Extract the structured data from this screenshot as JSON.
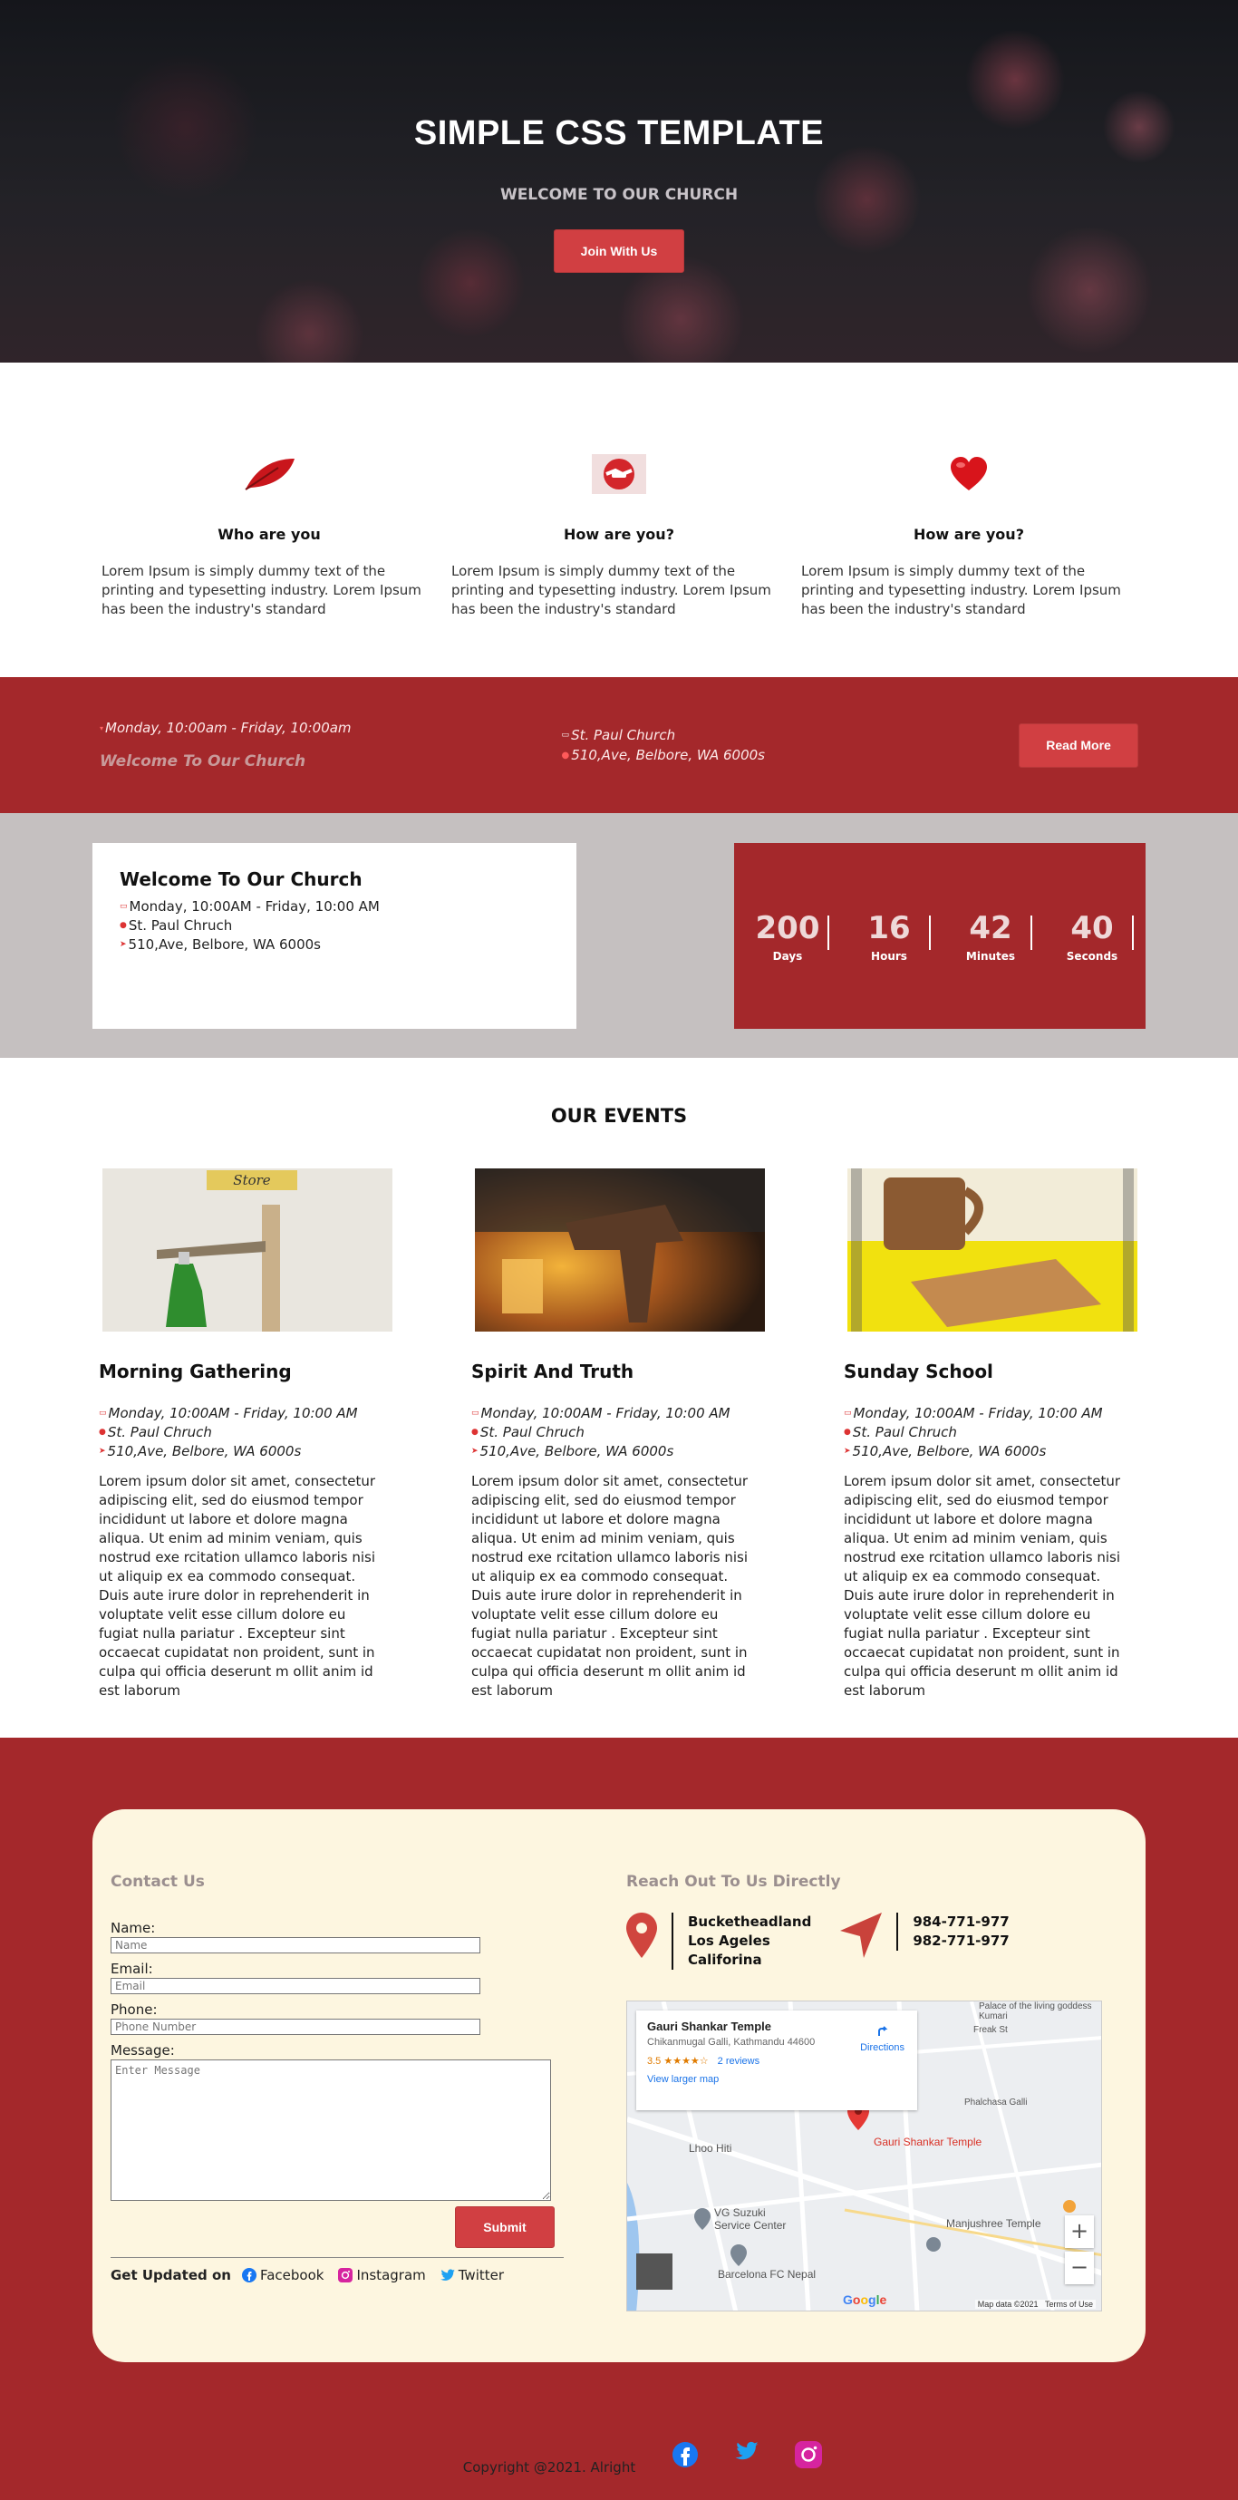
{
  "hero": {
    "title": "SIMPLE CSS TEMPLATE",
    "subtitle": "WELCOME TO OUR CHURCH",
    "button": "Join With Us"
  },
  "features": [
    {
      "icon": "leaf-icon",
      "title": "Who are you",
      "text": "Lorem Ipsum is simply dummy text of the printing and typesetting industry. Lorem Ipsum has been the industry's standard"
    },
    {
      "icon": "handshake-icon",
      "title": "How are you?",
      "text": "Lorem Ipsum is simply dummy text of the printing and typesetting industry. Lorem Ipsum has been the industry's standard"
    },
    {
      "icon": "heart-icon",
      "title": "How are you?",
      "text": "Lorem Ipsum is simply dummy text of the printing and typesetting industry. Lorem Ipsum has been the industry's standard"
    }
  ],
  "redbar": {
    "time": "Monday, 10:00am - Friday, 10:00am",
    "welcome": "Welcome To Our Church",
    "place": "St. Paul Church",
    "address": "510,Ave, Belbore, WA 6000s",
    "button": "Read More"
  },
  "welcome_card": {
    "title": "Welcome To Our Church",
    "time": "Monday, 10:00AM - Friday, 10:00 AM",
    "place": "St. Paul Chruch",
    "address": "510,Ave, Belbore, WA 6000s"
  },
  "countdown": [
    {
      "value": "200",
      "label": "Days"
    },
    {
      "value": "16",
      "label": "Hours"
    },
    {
      "value": "42",
      "label": "Minutes"
    },
    {
      "value": "40",
      "label": "Seconds"
    }
  ],
  "events": {
    "title": "OUR EVENTS",
    "items": [
      {
        "title": "Morning Gathering",
        "image_sign": "Store",
        "time": "Monday, 10:00AM - Friday, 10:00 AM",
        "place": "St. Paul Chruch",
        "address": "510,Ave, Belbore, WA 6000s",
        "text": "Lorem ipsum dolor sit amet, consectetur adipiscing elit, sed do eiusmod tempor incididunt ut labore et dolore magna aliqua. Ut enim ad minim veniam, quis nostrud exe rcitation ullamco laboris nisi ut aliquip ex ea commodo consequat. Duis aute irure dolor in reprehenderit in voluptate velit esse cillum dolore eu fugiat nulla pariatur . Excepteur sint occaecat cupidatat non proident, sunt in culpa qui officia deserunt m ollit anim id est laborum"
      },
      {
        "title": "Spirit And Truth",
        "time": "Monday, 10:00AM - Friday, 10:00 AM",
        "place": "St. Paul Chruch",
        "address": "510,Ave, Belbore, WA 6000s",
        "text": "Lorem ipsum dolor sit amet, consectetur adipiscing elit, sed do eiusmod tempor incididunt ut labore et dolore magna aliqua. Ut enim ad minim veniam, quis nostrud exe rcitation ullamco laboris nisi ut aliquip ex ea commodo consequat. Duis aute irure dolor in reprehenderit in voluptate velit esse cillum dolore eu fugiat nulla pariatur . Excepteur sint occaecat cupidatat non proident, sunt in culpa qui officia deserunt m ollit anim id est laborum"
      },
      {
        "title": "Sunday School",
        "time": "Monday, 10:00AM - Friday, 10:00 AM",
        "place": "St. Paul Chruch",
        "address": "510,Ave, Belbore, WA 6000s",
        "text": "Lorem ipsum dolor sit amet, consectetur adipiscing elit, sed do eiusmod tempor incididunt ut labore et dolore magna aliqua. Ut enim ad minim veniam, quis nostrud exe rcitation ullamco laboris nisi ut aliquip ex ea commodo consequat. Duis aute irure dolor in reprehenderit in voluptate velit esse cillum dolore eu fugiat nulla pariatur . Excepteur sint occaecat cupidatat non proident, sunt in culpa qui officia deserunt m ollit anim id est laborum"
      }
    ]
  },
  "contact": {
    "heading": "Contact Us",
    "name_label": "Name:",
    "name_placeholder": "Name",
    "email_label": "Email:",
    "email_placeholder": "Email",
    "phone_label": "Phone:",
    "phone_placeholder": "Phone Number",
    "message_label": "Message:",
    "message_placeholder": "Enter Message",
    "submit": "Submit",
    "updated_label": "Get Updated on",
    "facebook": "Facebook",
    "instagram": "Instagram",
    "twitter": "Twitter"
  },
  "reach": {
    "heading": "Reach Out To Us Directly",
    "address_lines": [
      "Bucketheadland",
      "Los Ageles",
      "Califorina"
    ],
    "phones": [
      "984-771-977",
      "982-771-977"
    ]
  },
  "map": {
    "place_name": "Gauri Shankar Temple",
    "place_address": "Chikanmugal Galli, Kathmandu 44600",
    "rating": "3.5 ★★★★☆",
    "reviews": "2 reviews",
    "larger_map": "View larger map",
    "directions": "Directions",
    "pin_label": "Gauri Shankar Temple",
    "labels": [
      "Lhoo Hiti",
      "VG Suzuki Service Center",
      "Barcelona FC Nepal",
      "Manjushree Temple",
      "Freak St",
      "Phalchasa Galli",
      "Palace of the living goddess Kumari"
    ],
    "attribution": "Map data ©2021",
    "terms": "Terms of Use",
    "google": "Google",
    "zoom_in": "+",
    "zoom_out": "−"
  },
  "footer": {
    "copyright": "Copyright @2021. Alright"
  },
  "colors": {
    "brand_red": "#a4282b",
    "button_red": "#d13f42",
    "cream": "#fdf6e0",
    "grey": "#c5c0c0"
  }
}
